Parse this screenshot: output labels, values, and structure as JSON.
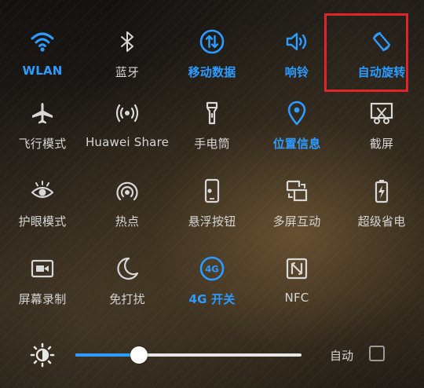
{
  "toggles": [
    {
      "label": "WLAN",
      "icon": "wifi-icon",
      "active": true
    },
    {
      "label": "蓝牙",
      "icon": "bluetooth-icon",
      "active": false
    },
    {
      "label": "移动数据",
      "icon": "mobile-data-icon",
      "active": true
    },
    {
      "label": "响铃",
      "icon": "ringer-icon",
      "active": true
    },
    {
      "label": "自动旋转",
      "icon": "auto-rotate-icon",
      "active": true
    },
    {
      "label": "飞行模式",
      "icon": "airplane-icon",
      "active": false
    },
    {
      "label": "Huawei Share",
      "icon": "huawei-share-icon",
      "active": false
    },
    {
      "label": "手电筒",
      "icon": "flashlight-icon",
      "active": false
    },
    {
      "label": "位置信息",
      "icon": "location-icon",
      "active": true
    },
    {
      "label": "截屏",
      "icon": "screenshot-icon",
      "active": false
    },
    {
      "label": "护眼模式",
      "icon": "eye-comfort-icon",
      "active": false
    },
    {
      "label": "热点",
      "icon": "hotspot-icon",
      "active": false
    },
    {
      "label": "悬浮按钮",
      "icon": "floating-button-icon",
      "active": false
    },
    {
      "label": "多屏互动",
      "icon": "multi-screen-icon",
      "active": false
    },
    {
      "label": "超级省电",
      "icon": "power-saving-icon",
      "active": false
    },
    {
      "label": "屏幕录制",
      "icon": "screen-record-icon",
      "active": false
    },
    {
      "label": "免打扰",
      "icon": "do-not-disturb-icon",
      "active": false
    },
    {
      "label": "4G 开关",
      "icon": "4g-icon",
      "active": true
    },
    {
      "label": "NFC",
      "icon": "nfc-icon",
      "active": false
    }
  ],
  "brightness": {
    "icon": "brightness-icon",
    "level": 0.28,
    "auto_label": "自动",
    "auto_checked": false
  },
  "colors": {
    "active": "#2d9cff",
    "inactive": "#d8d8d8",
    "highlight": "#e0242a"
  }
}
